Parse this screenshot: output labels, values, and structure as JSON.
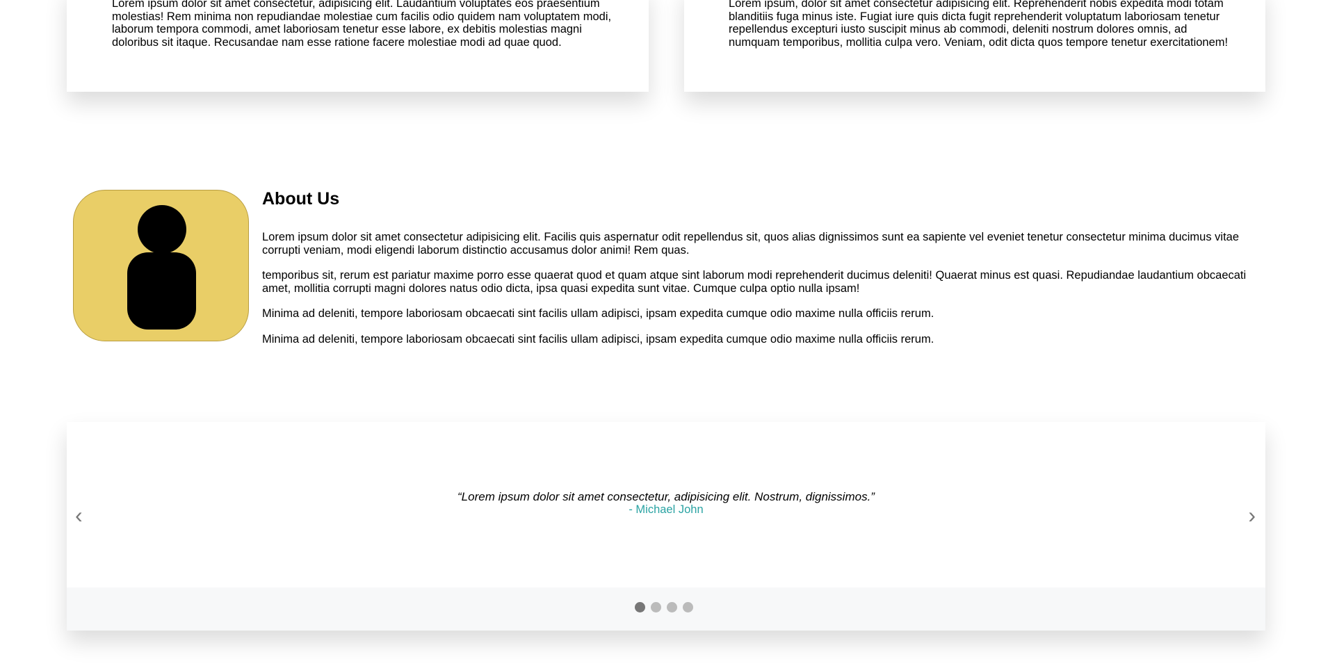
{
  "cards": [
    {
      "text": "Lorem ipsum dolor sit amet consectetur, adipisicing elit. Laudantium voluptates eos praesentium molestias! Rem minima non repudiandae molestiae cum facilis odio quidem nam voluptatem modi, laborum tempora commodi, amet laboriosam tenetur esse labore, ex debitis molestias magni doloribus sit itaque. Recusandae nam esse ratione facere molestiae modi ad quae quod."
    },
    {
      "text": "Lorem ipsum, dolor sit amet consectetur adipisicing elit. Reprehenderit nobis expedita modi totam blanditiis fuga minus iste. Fugiat iure quis dicta fugit reprehenderit voluptatum laboriosam tenetur repellendus excepturi iusto suscipit minus ab commodi, deleniti nostrum dolores omnis, ad numquam temporibus, mollitia culpa vero. Veniam, odit dicta quos tempore tenetur exercitationem!"
    }
  ],
  "about": {
    "title": "About Us",
    "image_icon": "person-icon",
    "image_bg": "#e9ce67",
    "paragraphs": [
      "Lorem ipsum dolor sit amet consectetur adipisicing elit. Facilis quis aspernatur odit repellendus sit, quos alias dignissimos sunt ea sapiente vel eveniet tenetur consectetur minima ducimus vitae corrupti veniam, modi eligendi laborum distinctio accusamus dolor animi! Rem quas.",
      "temporibus sit, rerum est pariatur maxime porro esse quaerat quod et quam atque sint laborum modi reprehenderit ducimus deleniti! Quaerat minus est quasi. Repudiandae laudantium obcaecati amet, mollitia corrupti magni dolores natus odio dicta, ipsa quasi expedita sunt vitae. Cumque culpa optio nulla ipsam!",
      "Minima ad deleniti, tempore laboriosam obcaecati sint facilis ullam adipisci, ipsam expedita cumque odio maxime nulla officiis rerum.",
      "Minima ad deleniti, tempore laboriosam obcaecati sint facilis ullam adipisci, ipsam expedita cumque odio maxime nulla officiis rerum."
    ]
  },
  "testimonial": {
    "quote": "“Lorem ipsum dolor sit amet consectetur, adipisicing elit. Nostrum, dignissimos.”",
    "author": "- Michael John",
    "author_color": "#2aa3a3",
    "prev_label": "‹",
    "next_label": "›",
    "slide_count": 4,
    "active_slide": 1
  }
}
